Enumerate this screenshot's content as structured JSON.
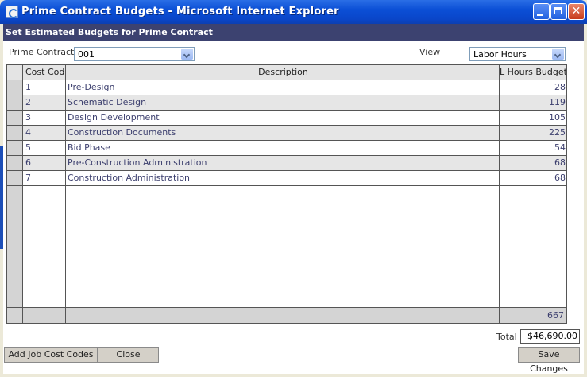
{
  "window": {
    "title": "Prime Contract Budgets - Microsoft Internet Explorer",
    "close_glyph": "✕"
  },
  "banner": {
    "title": "Set Estimated Budgets for Prime Contract"
  },
  "filters": {
    "prime_contract_label": "Prime Contract",
    "prime_contract_value": "001",
    "view_label": "View",
    "view_value": "Labor Hours"
  },
  "table": {
    "columns": [
      "Cost Code",
      "Description",
      "L Hours Budget"
    ],
    "rows": [
      {
        "code": "1",
        "description": "Pre-Design",
        "budget": "28"
      },
      {
        "code": "2",
        "description": "Schematic Design",
        "budget": "119"
      },
      {
        "code": "3",
        "description": "Design Development",
        "budget": "105"
      },
      {
        "code": "4",
        "description": "Construction Documents",
        "budget": "225"
      },
      {
        "code": "5",
        "description": "Bid Phase",
        "budget": "54"
      },
      {
        "code": "6",
        "description": "Pre-Construction Administration",
        "budget": "68"
      },
      {
        "code": "7",
        "description": "Construction Administration",
        "budget": "68"
      }
    ],
    "column_total": "667"
  },
  "footer": {
    "total_label": "Total",
    "total_value": "$46,690.00",
    "add_button": "Add Job Cost Codes",
    "close_button": "Close",
    "save_button": "Save Changes"
  }
}
